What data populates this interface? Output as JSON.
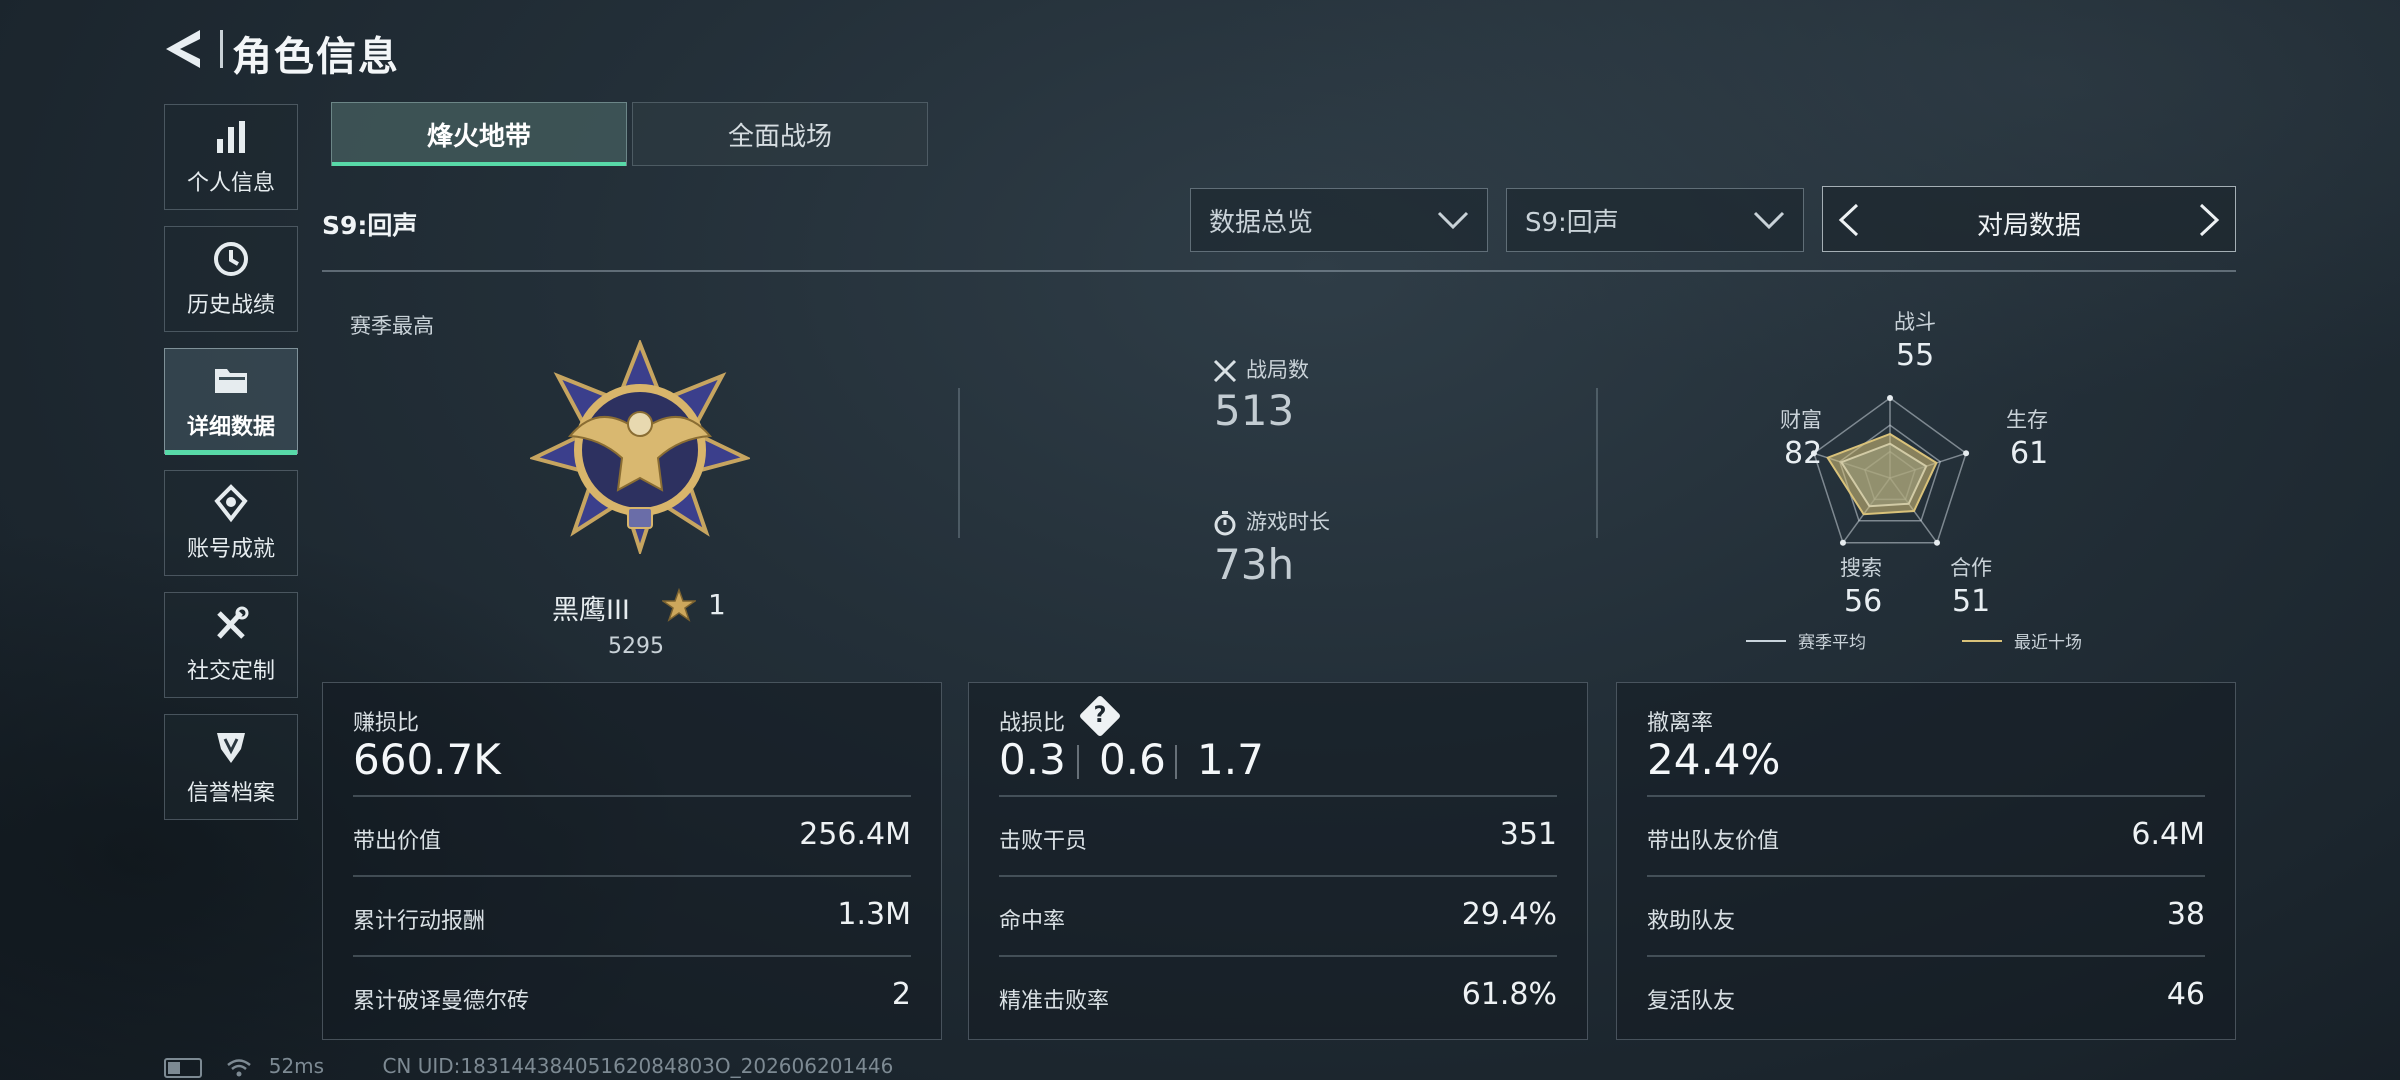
{
  "header": {
    "title": "角色信息"
  },
  "sidebar": {
    "items": [
      {
        "label": "个人信息",
        "icon": "bar-chart-icon"
      },
      {
        "label": "历史战绩",
        "icon": "clock-icon"
      },
      {
        "label": "详细数据",
        "icon": "folder-icon",
        "active": true
      },
      {
        "label": "账号成就",
        "icon": "achievement-icon"
      },
      {
        "label": "社交定制",
        "icon": "tools-icon"
      },
      {
        "label": "信誉档案",
        "icon": "shield-icon"
      }
    ]
  },
  "tabs": [
    {
      "label": "烽火地带",
      "active": true
    },
    {
      "label": "全面战场",
      "active": false
    }
  ],
  "season_label": "S9:回声",
  "filters": {
    "dropdown1": "数据总览",
    "dropdown2": "S9:回声",
    "nav_label": "对局数据"
  },
  "rank": {
    "section_label": "赛季最高",
    "name": "黑鹰III",
    "stars": "1",
    "score": "5295"
  },
  "stats": {
    "matches_label": "战局数",
    "matches_value": "513",
    "playtime_label": "游戏时长",
    "playtime_value": "73h"
  },
  "radar": {
    "axes": [
      {
        "label": "战斗",
        "value": "55"
      },
      {
        "label": "生存",
        "value": "61"
      },
      {
        "label": "合作",
        "value": "51"
      },
      {
        "label": "搜索",
        "value": "56"
      },
      {
        "label": "财富",
        "value": "82"
      }
    ],
    "legend_avg": "赛季平均",
    "legend_recent": "最近十场",
    "colors": {
      "avg": "#c9d4dc",
      "recent": "#d9c27a"
    }
  },
  "cards": {
    "profit": {
      "title": "赚损比",
      "big": "660.7K",
      "rows": [
        {
          "label": "带出价值",
          "value": "256.4M"
        },
        {
          "label": "累计行动报酬",
          "value": "1.3M"
        },
        {
          "label": "累计破译曼德尔砖",
          "value": "2"
        }
      ]
    },
    "kd": {
      "title": "战损比",
      "help": "?",
      "values": [
        "0.3",
        "0.6",
        "1.7"
      ],
      "rows": [
        {
          "label": "击败干员",
          "value": "351"
        },
        {
          "label": "命中率",
          "value": "29.4%"
        },
        {
          "label": "精准击败率",
          "value": "61.8%"
        }
      ]
    },
    "extract": {
      "title": "撤离率",
      "big": "24.4%",
      "rows": [
        {
          "label": "带出队友价值",
          "value": "6.4M"
        },
        {
          "label": "救助队友",
          "value": "38"
        },
        {
          "label": "复活队友",
          "value": "46"
        }
      ]
    }
  },
  "status_bar": {
    "ping": "52ms",
    "uid": "CN UID:18314438405162084803O_20260620144​6"
  },
  "colors": {
    "accent": "#58d9a8"
  }
}
